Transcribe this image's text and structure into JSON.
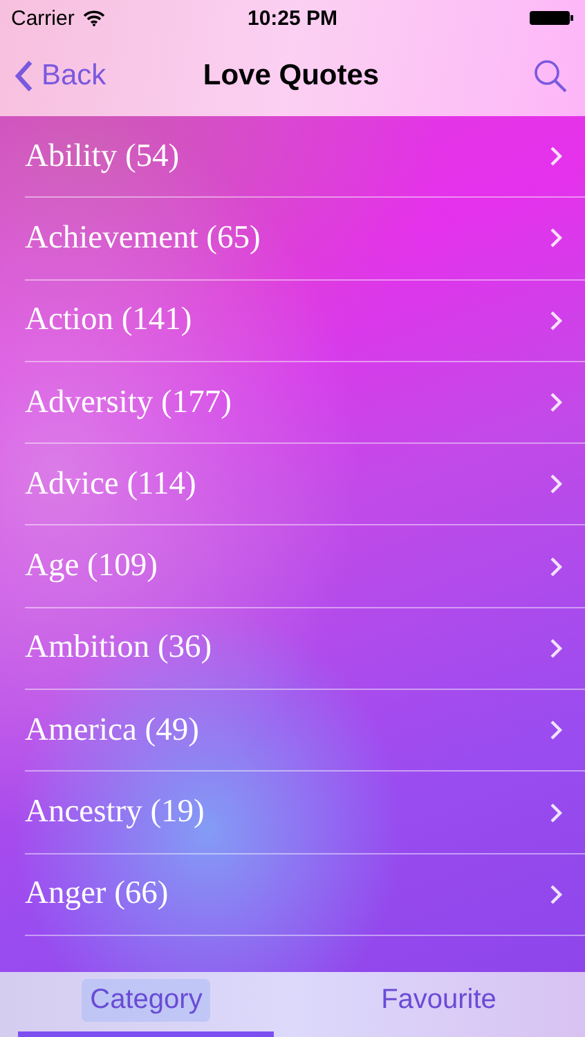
{
  "status_bar": {
    "carrier": "Carrier",
    "time": "10:25 PM"
  },
  "nav_bar": {
    "back": "Back",
    "title": "Love Quotes"
  },
  "categories": [
    {
      "label": "Ability (54)"
    },
    {
      "label": "Achievement (65)"
    },
    {
      "label": "Action (141)"
    },
    {
      "label": "Adversity (177)"
    },
    {
      "label": "Advice (114)"
    },
    {
      "label": "Age (109)"
    },
    {
      "label": "Ambition (36)"
    },
    {
      "label": "America (49)"
    },
    {
      "label": "Ancestry (19)"
    },
    {
      "label": "Anger (66)"
    }
  ],
  "tabs": [
    {
      "label": "Category",
      "selected": true
    },
    {
      "label": "Favourite",
      "selected": false
    }
  ]
}
